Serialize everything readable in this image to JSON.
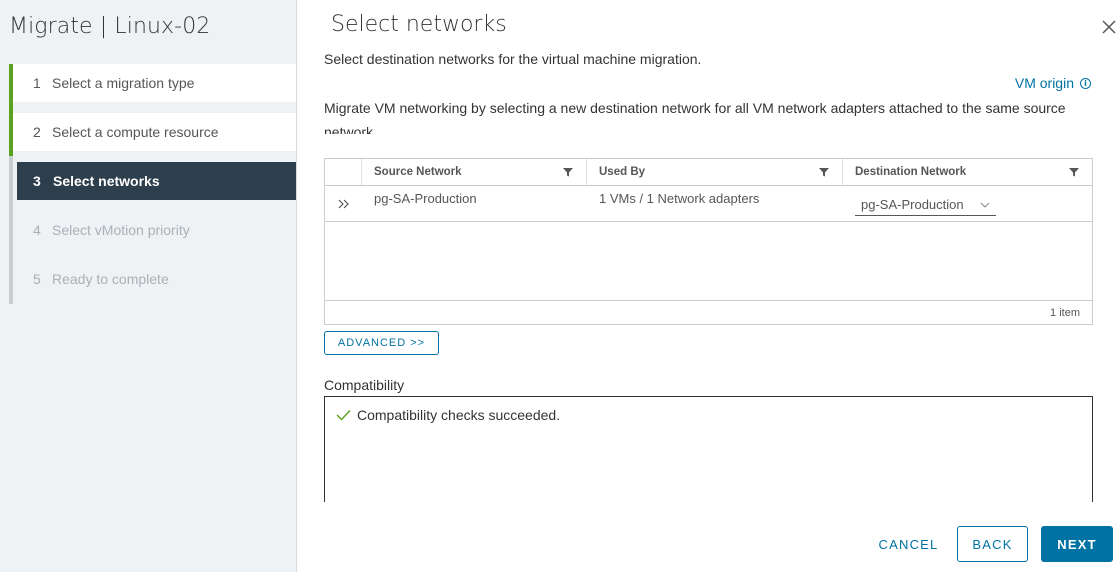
{
  "sidebar": {
    "title": "Migrate | Linux-02",
    "steps": [
      {
        "num": "1",
        "label": "Select a migration type",
        "state": "done"
      },
      {
        "num": "2",
        "label": "Select a compute resource",
        "state": "done"
      },
      {
        "num": "3",
        "label": "Select networks",
        "state": "current"
      },
      {
        "num": "4",
        "label": "Select vMotion priority",
        "state": "disabled"
      },
      {
        "num": "5",
        "label": "Ready to complete",
        "state": "disabled"
      }
    ]
  },
  "main": {
    "title": "Select networks",
    "subtitle": "Select destination networks for the virtual machine migration.",
    "vm_origin_label": "VM origin",
    "description": "Migrate VM networking by selecting a new destination network for all VM network adapters attached to the same source network.",
    "grid": {
      "columns": [
        "Source Network",
        "Used By",
        "Destination Network"
      ],
      "rows": [
        {
          "source": "pg-SA-Production",
          "used_by": "1 VMs / 1 Network adapters",
          "destination": "pg-SA-Production"
        }
      ],
      "footer": "1 item"
    },
    "advanced_label": "ADVANCED >>",
    "compatibility": {
      "label": "Compatibility",
      "message": "Compatibility checks succeeded."
    }
  },
  "footer": {
    "cancel": "CANCEL",
    "back": "BACK",
    "next": "NEXT"
  },
  "colors": {
    "accent": "#0072a3",
    "success": "#5aa220",
    "current_step_bg": "#2d3e4c",
    "sidebar_bg": "#eef2f5"
  },
  "icons": {
    "close": "close-icon",
    "info": "info-icon",
    "filter": "filter-icon",
    "expand": "double-chevron-right-icon",
    "dropdown": "chevron-down-icon",
    "check": "checkmark-icon"
  }
}
